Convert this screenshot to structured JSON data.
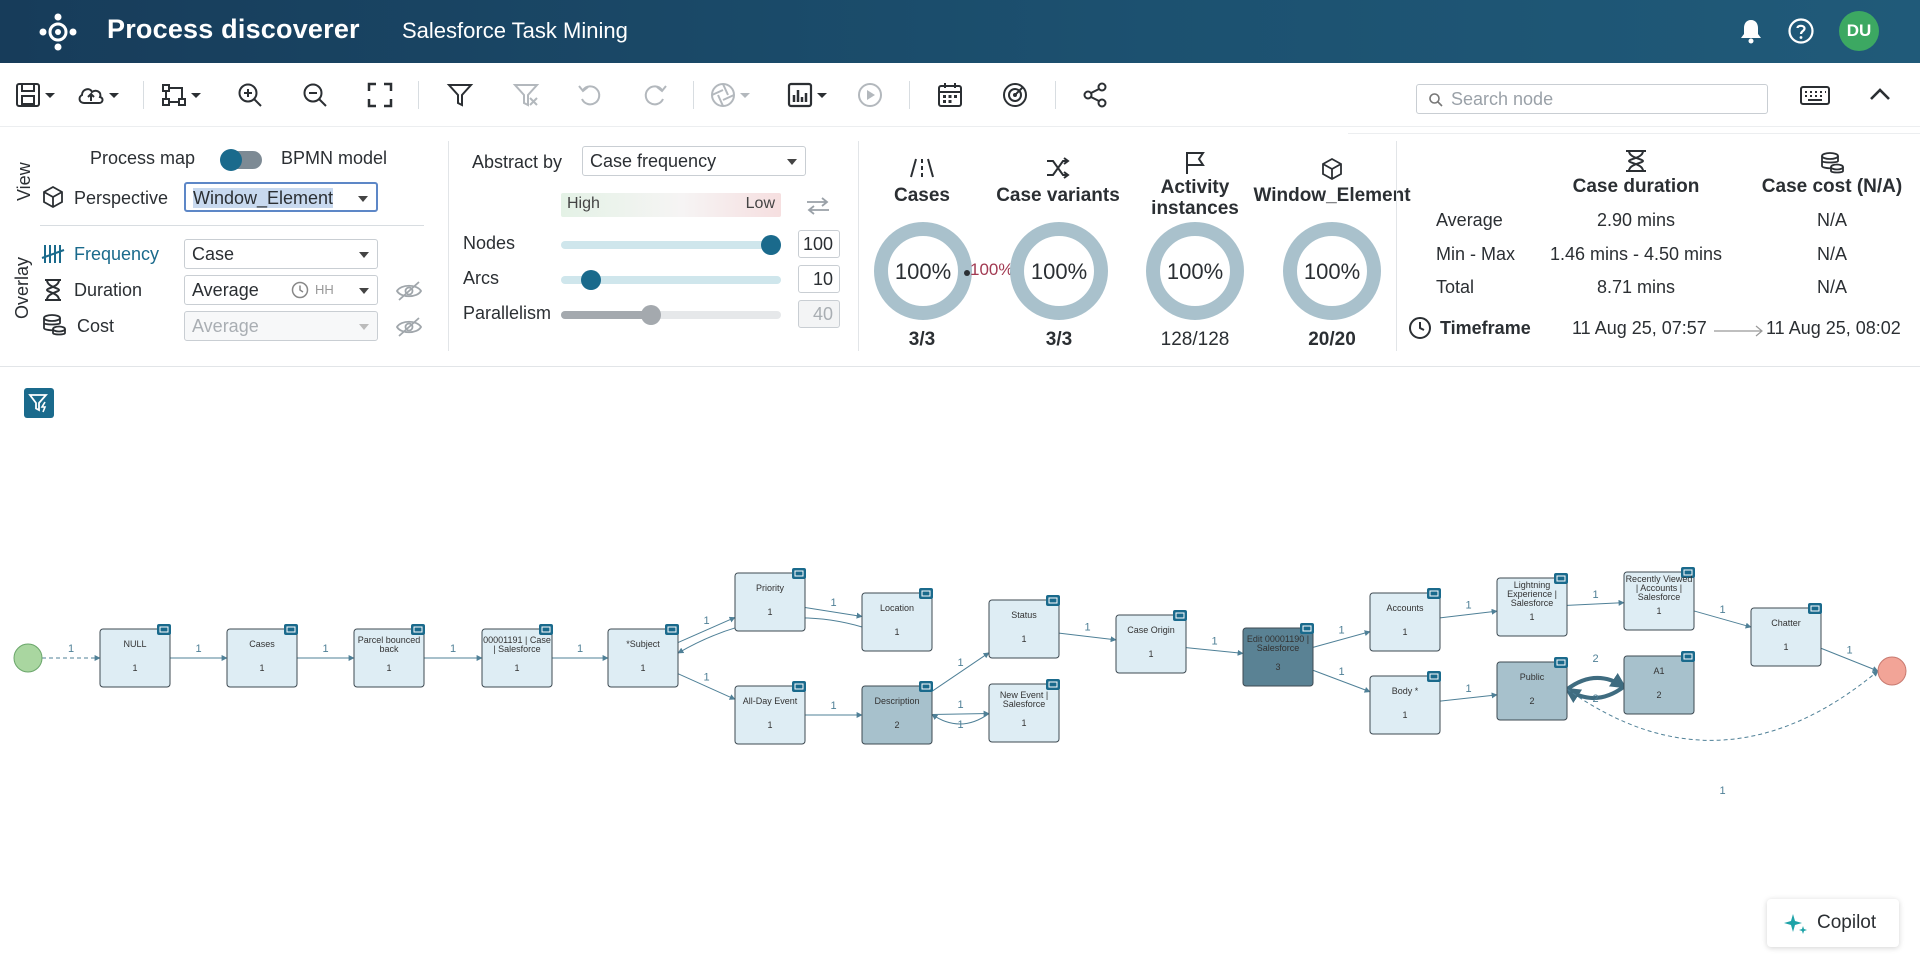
{
  "header": {
    "app_title": "Process discoverer",
    "project_title": "Salesforce Task Mining",
    "avatar_initials": "DU"
  },
  "toolbar": {
    "search_placeholder": "Search node"
  },
  "view": {
    "section_label": "View",
    "process_map_label": "Process map",
    "bpmn_label": "BPMN model",
    "perspective_label": "Perspective",
    "perspective_value": "Window_Element"
  },
  "overlay": {
    "section_label": "Overlay",
    "frequency_label": "Frequency",
    "frequency_value": "Case",
    "duration_label": "Duration",
    "duration_value": "Average",
    "duration_unit": "HH",
    "cost_label": "Cost",
    "cost_value": "Average"
  },
  "abstraction": {
    "abstract_by_label": "Abstract by",
    "abstract_by_value": "Case frequency",
    "high_label": "High",
    "low_label": "Low",
    "nodes_label": "Nodes",
    "nodes_value": "100",
    "nodes_level": 100,
    "arcs_label": "Arcs",
    "arcs_value": "10",
    "arcs_level": 10,
    "parallelism_label": "Parallelism",
    "parallelism_value": "40",
    "parallelism_level": 40
  },
  "stats": {
    "cases": {
      "title": "Cases",
      "pct": "100%",
      "count": "3/3"
    },
    "variants": {
      "title": "Case variants",
      "pct": "100%",
      "count": "3/3"
    },
    "link_pct": "100%",
    "activities": {
      "title_line1": "Activity",
      "title_line2": "instances",
      "pct": "100%",
      "count": "128/128"
    },
    "window": {
      "title": "Window_Element",
      "pct": "100%",
      "count": "20/20"
    }
  },
  "summary": {
    "duration_header": "Case duration",
    "cost_header": "Case cost (N/A)",
    "rows": [
      {
        "label": "Average",
        "duration": "2.90 mins",
        "cost": "N/A"
      },
      {
        "label": "Min - Max",
        "duration": "1.46 mins - 4.50 mins",
        "cost": "N/A"
      },
      {
        "label": "Total",
        "duration": "8.71 mins",
        "cost": "N/A"
      }
    ],
    "timeframe_label": "Timeframe",
    "timeframe_start": "11 Aug 25, 07:57",
    "timeframe_end": "11 Aug 25, 08:02"
  },
  "graph": {
    "nodes": [
      {
        "id": "null",
        "lines": [
          "NULL"
        ],
        "count": "1"
      },
      {
        "id": "cases",
        "lines": [
          "Cases"
        ],
        "count": "1"
      },
      {
        "id": "parcel",
        "lines": [
          "Parcel bounced",
          "back"
        ],
        "count": "1"
      },
      {
        "id": "case00001191",
        "lines": [
          "00001191 | Case",
          "| Salesforce"
        ],
        "count": "1"
      },
      {
        "id": "subject",
        "lines": [
          "*Subject"
        ],
        "count": "1"
      },
      {
        "id": "priority",
        "lines": [
          "Priority"
        ],
        "count": "1"
      },
      {
        "id": "allday",
        "lines": [
          "All-Day Event"
        ],
        "count": "1"
      },
      {
        "id": "location",
        "lines": [
          "Location"
        ],
        "count": "1"
      },
      {
        "id": "description",
        "lines": [
          "Description"
        ],
        "count": "2"
      },
      {
        "id": "status",
        "lines": [
          "Status"
        ],
        "count": "1"
      },
      {
        "id": "newevent",
        "lines": [
          "New Event |",
          "Salesforce"
        ],
        "count": "1"
      },
      {
        "id": "caseorigin",
        "lines": [
          "Case Origin"
        ],
        "count": "1"
      },
      {
        "id": "edit",
        "lines": [
          "Edit 00001190 |",
          "Salesforce"
        ],
        "count": "3"
      },
      {
        "id": "accounts",
        "lines": [
          "Accounts"
        ],
        "count": "1"
      },
      {
        "id": "body",
        "lines": [
          "Body *"
        ],
        "count": "1"
      },
      {
        "id": "lightning",
        "lines": [
          "Lightning",
          "Experience |",
          "Salesforce"
        ],
        "count": "1"
      },
      {
        "id": "public",
        "lines": [
          "Public"
        ],
        "count": "2"
      },
      {
        "id": "recent",
        "lines": [
          "Recently Viewed",
          "| Accounts |",
          "Salesforce"
        ],
        "count": "1"
      },
      {
        "id": "a1",
        "lines": [
          "A1"
        ],
        "count": "2"
      },
      {
        "id": "chatter",
        "lines": [
          "Chatter"
        ],
        "count": "1"
      }
    ],
    "edge_labels": [
      "1",
      "1",
      "1",
      "1",
      "1",
      "1",
      "1",
      "1",
      "1",
      "1",
      "1",
      "1",
      "1",
      "1",
      "1",
      "1",
      "1",
      "1",
      "1",
      "1",
      "1",
      "2",
      "2",
      "1",
      "1"
    ]
  },
  "copilot_label": "Copilot",
  "colors": {
    "header_bg": "#1c5170",
    "accent": "#1a6a8c",
    "avatar_bg": "#3ca862",
    "donut_ring": "#a9c1cc",
    "node_fill": "#deedf4",
    "node_fill_mid": "#a7c1cc",
    "node_fill_dark": "#5a8294",
    "start": "#a9d6a0",
    "end": "#f2a497"
  }
}
